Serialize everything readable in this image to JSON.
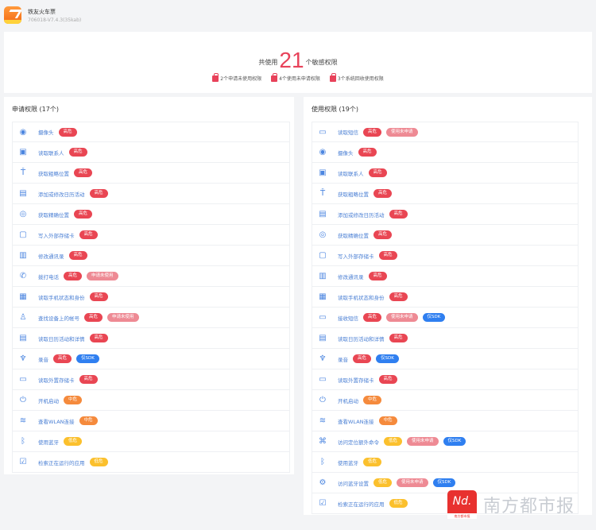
{
  "app": {
    "name": "铁友火车票",
    "version": "706018-V7.4.3(35kab)"
  },
  "summary": {
    "prefix": "共使用",
    "count": "21",
    "suffix": "个敏感权限",
    "stats": [
      {
        "text": "2个申请未使用权限"
      },
      {
        "text": "4个使用未申请权限"
      },
      {
        "text": "3个系统回收使用权限"
      }
    ]
  },
  "colors": {
    "high": "#e94653",
    "mid": "#f58a3c",
    "low": "#fbc02d",
    "pink": "#ee8a94",
    "blue": "#2f7ff0",
    "accent": "#e8425a"
  },
  "left": {
    "title": "申请权限 (17个)",
    "items": [
      {
        "icon": "camera",
        "label": "摄像头",
        "badges": [
          [
            "high",
            "高危"
          ]
        ]
      },
      {
        "icon": "contacts",
        "label": "读取联系人",
        "badges": [
          [
            "high",
            "高危"
          ]
        ]
      },
      {
        "icon": "antenna",
        "label": "获取粗略位置",
        "badges": [
          [
            "high",
            "高危"
          ]
        ]
      },
      {
        "icon": "calendar-edit",
        "label": "添加或修改日历活动",
        "badges": [
          [
            "high",
            "高危"
          ]
        ]
      },
      {
        "icon": "location",
        "label": "获取精确位置",
        "badges": [
          [
            "high",
            "高危"
          ]
        ]
      },
      {
        "icon": "storage-write",
        "label": "写入外部存储卡",
        "badges": [
          [
            "high",
            "高危"
          ]
        ]
      },
      {
        "icon": "contacts-edit",
        "label": "修改通讯录",
        "badges": [
          [
            "high",
            "高危"
          ]
        ]
      },
      {
        "icon": "phone",
        "label": "拨打电话",
        "badges": [
          [
            "high",
            "高危"
          ],
          [
            "pink",
            "申请未使用"
          ]
        ]
      },
      {
        "icon": "phone-state",
        "label": "读取手机状态和身份",
        "badges": [
          [
            "high",
            "高危"
          ]
        ]
      },
      {
        "icon": "account",
        "label": "查找设备上的帐号",
        "badges": [
          [
            "high",
            "高危"
          ],
          [
            "pink",
            "申请未使用"
          ]
        ]
      },
      {
        "icon": "calendar",
        "label": "读取日历活动和详情",
        "badges": [
          [
            "high",
            "高危"
          ]
        ]
      },
      {
        "icon": "microphone",
        "label": "录音",
        "badges": [
          [
            "high",
            "高危"
          ],
          [
            "blue",
            "仅SDK"
          ]
        ]
      },
      {
        "icon": "storage",
        "label": "读取外置存储卡",
        "badges": [
          [
            "high",
            "高危"
          ]
        ]
      },
      {
        "icon": "power",
        "label": "开机启动",
        "badges": [
          [
            "mid",
            "中危"
          ]
        ]
      },
      {
        "icon": "wifi",
        "label": "查看WLAN连接",
        "badges": [
          [
            "mid",
            "中危"
          ]
        ]
      },
      {
        "icon": "bluetooth",
        "label": "使用蓝牙",
        "badges": [
          [
            "low",
            "低危"
          ]
        ]
      },
      {
        "icon": "task",
        "label": "检索正在运行的应用",
        "badges": [
          [
            "low",
            "低危"
          ]
        ]
      }
    ]
  },
  "right": {
    "title": "使用权限 (19个)",
    "items": [
      {
        "icon": "sms",
        "label": "读取短信",
        "badges": [
          [
            "high",
            "高危"
          ],
          [
            "pink",
            "使用未申请"
          ]
        ]
      },
      {
        "icon": "camera",
        "label": "摄像头",
        "badges": [
          [
            "high",
            "高危"
          ]
        ]
      },
      {
        "icon": "contacts",
        "label": "读取联系人",
        "badges": [
          [
            "high",
            "高危"
          ]
        ]
      },
      {
        "icon": "antenna",
        "label": "获取粗略位置",
        "badges": [
          [
            "high",
            "高危"
          ]
        ]
      },
      {
        "icon": "calendar-edit",
        "label": "添加或修改日历活动",
        "badges": [
          [
            "high",
            "高危"
          ]
        ]
      },
      {
        "icon": "location",
        "label": "获取精确位置",
        "badges": [
          [
            "high",
            "高危"
          ]
        ]
      },
      {
        "icon": "storage-write",
        "label": "写入外部存储卡",
        "badges": [
          [
            "high",
            "高危"
          ]
        ]
      },
      {
        "icon": "contacts-edit",
        "label": "修改通讯录",
        "badges": [
          [
            "high",
            "高危"
          ]
        ]
      },
      {
        "icon": "phone-state",
        "label": "读取手机状态和身份",
        "badges": [
          [
            "high",
            "高危"
          ]
        ]
      },
      {
        "icon": "sms-receive",
        "label": "接收短信",
        "badges": [
          [
            "high",
            "高危"
          ],
          [
            "pink",
            "使用未申请"
          ],
          [
            "blue",
            "仅SDK"
          ]
        ]
      },
      {
        "icon": "calendar",
        "label": "读取日历活动和详情",
        "badges": [
          [
            "high",
            "高危"
          ]
        ]
      },
      {
        "icon": "microphone",
        "label": "录音",
        "badges": [
          [
            "high",
            "高危"
          ],
          [
            "blue",
            "仅SDK"
          ]
        ]
      },
      {
        "icon": "storage",
        "label": "读取外置存储卡",
        "badges": [
          [
            "high",
            "高危"
          ]
        ]
      },
      {
        "icon": "power",
        "label": "开机启动",
        "badges": [
          [
            "mid",
            "中危"
          ]
        ]
      },
      {
        "icon": "wifi",
        "label": "查看WLAN连接",
        "badges": [
          [
            "mid",
            "中危"
          ]
        ]
      },
      {
        "icon": "command",
        "label": "访问定位额外命令",
        "badges": [
          [
            "low",
            "低危"
          ],
          [
            "pink",
            "使用未申请"
          ],
          [
            "blue",
            "仅SDK"
          ]
        ]
      },
      {
        "icon": "bluetooth",
        "label": "使用蓝牙",
        "badges": [
          [
            "low",
            "低危"
          ]
        ]
      },
      {
        "icon": "bluetooth-settings",
        "label": "访问蓝牙设置",
        "badges": [
          [
            "low",
            "低危"
          ],
          [
            "pink",
            "使用未申请"
          ],
          [
            "blue",
            "仅SDK"
          ]
        ]
      },
      {
        "icon": "task",
        "label": "检索正在运行的应用",
        "badges": [
          [
            "low",
            "低危"
          ]
        ]
      }
    ]
  },
  "watermark": {
    "logo": "Nd.",
    "logo_sub": "南方都市报",
    "text": "南方都市报"
  }
}
